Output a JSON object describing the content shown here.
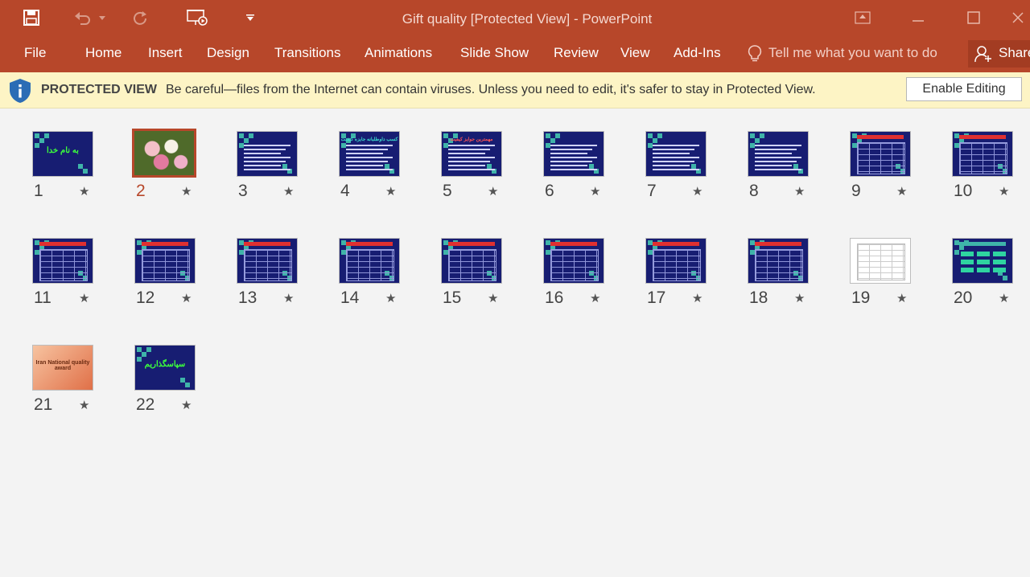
{
  "window": {
    "title": "Gift quality [Protected View] - PowerPoint"
  },
  "ribbon": {
    "tabs": [
      "File",
      "Home",
      "Insert",
      "Design",
      "Transitions",
      "Animations",
      "Slide Show",
      "Review",
      "View",
      "Add-Ins"
    ],
    "tell_me": "Tell me what you want to do",
    "share": "Share"
  },
  "protected_view": {
    "title": "PROTECTED VIEW",
    "message": "Be careful—files from the Internet can contain viruses. Unless you need to edit, it's safer to stay in Protected View.",
    "button": "Enable Editing"
  },
  "colors": {
    "accent": "#b7472a",
    "slide_bg": "#171d72",
    "teal": "#3fb4a9",
    "warning_bg": "#fdf4c5"
  },
  "slides": [
    {
      "number": "1",
      "kind": "title",
      "text": "به نام خدا"
    },
    {
      "number": "2",
      "kind": "image",
      "text": "",
      "selected": true
    },
    {
      "number": "3",
      "kind": "text"
    },
    {
      "number": "4",
      "kind": "title-text",
      "text": "کسب داوطلبانه جایزه کیفیت"
    },
    {
      "number": "5",
      "kind": "title-text",
      "text": "مهمترین جوایز کیفیت"
    },
    {
      "number": "6",
      "kind": "text"
    },
    {
      "number": "7",
      "kind": "text"
    },
    {
      "number": "8",
      "kind": "text"
    },
    {
      "number": "9",
      "kind": "table"
    },
    {
      "number": "10",
      "kind": "table"
    },
    {
      "number": "11",
      "kind": "table"
    },
    {
      "number": "12",
      "kind": "table"
    },
    {
      "number": "13",
      "kind": "table"
    },
    {
      "number": "14",
      "kind": "table"
    },
    {
      "number": "15",
      "kind": "table"
    },
    {
      "number": "16",
      "kind": "table"
    },
    {
      "number": "17",
      "kind": "table"
    },
    {
      "number": "18",
      "kind": "table"
    },
    {
      "number": "19",
      "kind": "white-table"
    },
    {
      "number": "20",
      "kind": "diagram"
    },
    {
      "number": "21",
      "kind": "orange",
      "text": "Iran National quality award"
    },
    {
      "number": "22",
      "kind": "title",
      "text": "سپاسگذاریم"
    }
  ]
}
